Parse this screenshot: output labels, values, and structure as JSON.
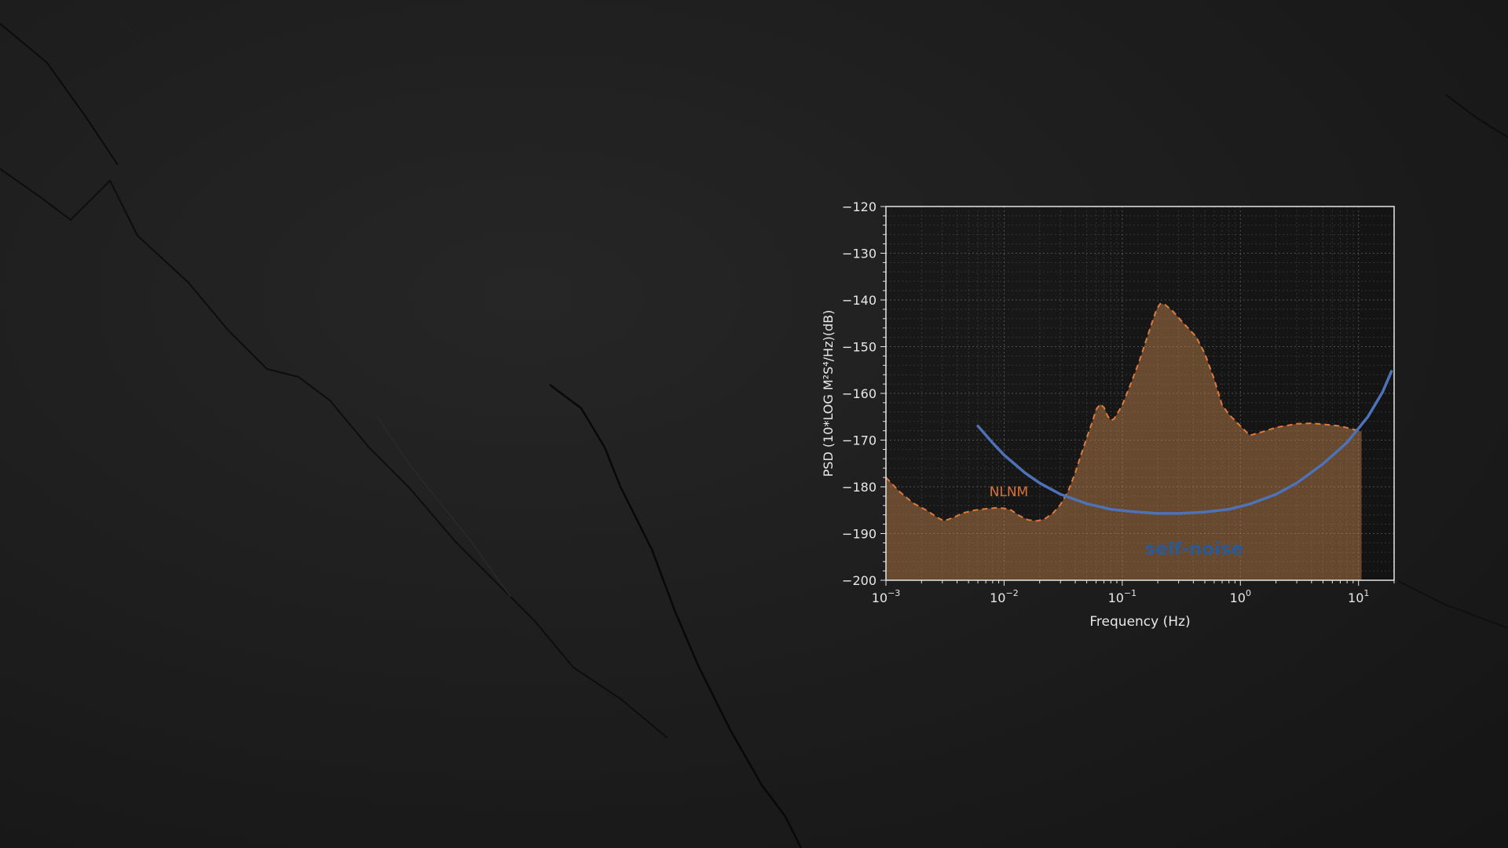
{
  "chart_data": {
    "type": "line",
    "title": "",
    "xlabel": "Frequency (Hz)",
    "ylabel": "PSD (10*LOG M²S⁴/Hz)(dB)",
    "xscale": "log",
    "xlim": [
      0.001,
      20
    ],
    "ylim": [
      -200,
      -120
    ],
    "grid": true,
    "y_ticks": [
      {
        "value": -120,
        "label": "−120"
      },
      {
        "value": -130,
        "label": "−130"
      },
      {
        "value": -140,
        "label": "−140"
      },
      {
        "value": -150,
        "label": "−150"
      },
      {
        "value": -160,
        "label": "−160"
      },
      {
        "value": -170,
        "label": "−170"
      },
      {
        "value": -180,
        "label": "−180"
      },
      {
        "value": -190,
        "label": "−190"
      },
      {
        "value": -200,
        "label": "−200"
      }
    ],
    "x_ticks": [
      {
        "value": 0.001,
        "base": "10",
        "exp": "−3"
      },
      {
        "value": 0.01,
        "base": "10",
        "exp": "−2"
      },
      {
        "value": 0.1,
        "base": "10",
        "exp": "−1"
      },
      {
        "value": 1,
        "base": "10",
        "exp": "0"
      },
      {
        "value": 10,
        "base": "10",
        "exp": "1"
      }
    ],
    "series": [
      {
        "name": "NLNM",
        "style": "dashed-filled",
        "color": "#e07a3a",
        "fill": "#c98a4e",
        "points": [
          [
            0.001,
            -178
          ],
          [
            0.0013,
            -181
          ],
          [
            0.0017,
            -183.5
          ],
          [
            0.0022,
            -185
          ],
          [
            0.0027,
            -186.5
          ],
          [
            0.0031,
            -187.3
          ],
          [
            0.0037,
            -186.6
          ],
          [
            0.0045,
            -185.6
          ],
          [
            0.0056,
            -185
          ],
          [
            0.007,
            -184.7
          ],
          [
            0.0085,
            -184.5
          ],
          [
            0.01,
            -184.6
          ],
          [
            0.0115,
            -185
          ],
          [
            0.0135,
            -186.2
          ],
          [
            0.016,
            -187.1
          ],
          [
            0.019,
            -187.3
          ],
          [
            0.022,
            -186.9
          ],
          [
            0.026,
            -185.6
          ],
          [
            0.03,
            -183.8
          ],
          [
            0.035,
            -180.8
          ],
          [
            0.04,
            -177
          ],
          [
            0.045,
            -173
          ],
          [
            0.05,
            -169.5
          ],
          [
            0.056,
            -166
          ],
          [
            0.06,
            -163.5
          ],
          [
            0.065,
            -162.3
          ],
          [
            0.07,
            -163
          ],
          [
            0.075,
            -164.8
          ],
          [
            0.08,
            -165.8
          ],
          [
            0.085,
            -165.5
          ],
          [
            0.09,
            -164.5
          ],
          [
            0.1,
            -162.5
          ],
          [
            0.12,
            -157.5
          ],
          [
            0.14,
            -153
          ],
          [
            0.17,
            -146.5
          ],
          [
            0.195,
            -142
          ],
          [
            0.21,
            -140.8
          ],
          [
            0.23,
            -141
          ],
          [
            0.27,
            -142.5
          ],
          [
            0.33,
            -145
          ],
          [
            0.42,
            -147.8
          ],
          [
            0.5,
            -151.5
          ],
          [
            0.6,
            -157
          ],
          [
            0.7,
            -162.5
          ],
          [
            0.8,
            -164.5
          ],
          [
            1,
            -167
          ],
          [
            1.2,
            -169
          ],
          [
            1.5,
            -168.3
          ],
          [
            2,
            -167.3
          ],
          [
            3,
            -166.5
          ],
          [
            4,
            -166.4
          ],
          [
            5,
            -166.6
          ],
          [
            7,
            -167
          ],
          [
            10,
            -168
          ],
          [
            10.6,
            -168.2
          ]
        ]
      },
      {
        "name": "self-noise",
        "style": "solid",
        "color": "#4e72b8",
        "points": [
          [
            0.006,
            -167
          ],
          [
            0.008,
            -170.6
          ],
          [
            0.01,
            -173.2
          ],
          [
            0.015,
            -177
          ],
          [
            0.02,
            -179.2
          ],
          [
            0.03,
            -181.6
          ],
          [
            0.05,
            -183.6
          ],
          [
            0.08,
            -184.8
          ],
          [
            0.12,
            -185.3
          ],
          [
            0.2,
            -185.7
          ],
          [
            0.3,
            -185.7
          ],
          [
            0.5,
            -185.4
          ],
          [
            0.8,
            -184.8
          ],
          [
            1.2,
            -183.7
          ],
          [
            2,
            -181.6
          ],
          [
            3,
            -179.2
          ],
          [
            5,
            -175.1
          ],
          [
            8,
            -170.5
          ],
          [
            12,
            -165
          ],
          [
            16,
            -159.7
          ],
          [
            19,
            -155.3
          ]
        ]
      }
    ],
    "annotations": [
      {
        "text": "NLNM",
        "x": 0.0075,
        "y": -182,
        "color": "#d8743a"
      },
      {
        "text": "self-noise",
        "x": 0.155,
        "y": -194.5,
        "color": "#2a5a96"
      }
    ]
  }
}
